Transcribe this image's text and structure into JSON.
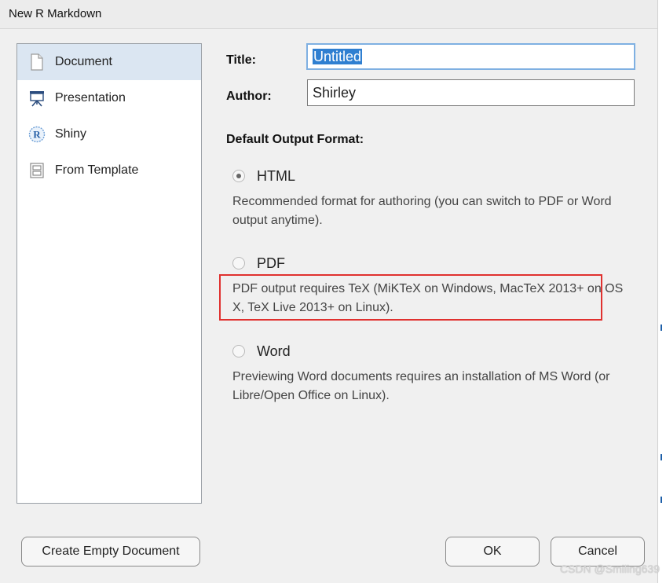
{
  "window": {
    "title": "New R Markdown"
  },
  "sidebar": {
    "items": [
      {
        "label": "Document",
        "icon": "document-icon",
        "selected": true
      },
      {
        "label": "Presentation",
        "icon": "presentation-icon",
        "selected": false
      },
      {
        "label": "Shiny",
        "icon": "shiny-r-icon",
        "selected": false
      },
      {
        "label": "From Template",
        "icon": "template-icon",
        "selected": false
      }
    ],
    "shiny_icon_glyph": "R"
  },
  "form": {
    "title_label": "Title:",
    "title_value": "Untitled",
    "author_label": "Author:",
    "author_value": "Shirley",
    "default_output_format_label": "Default Output Format:"
  },
  "formats": [
    {
      "label": "HTML",
      "checked": true,
      "description": "Recommended format for authoring (you can switch to PDF or Word output anytime)."
    },
    {
      "label": "PDF",
      "checked": false,
      "description": "PDF output requires TeX (MiKTeX on Windows, MacTeX 2013+ on OS X, TeX Live 2013+ on Linux)."
    },
    {
      "label": "Word",
      "checked": false,
      "description": "Previewing Word documents requires an installation of MS Word (or Libre/Open Office on Linux)."
    }
  ],
  "buttons": {
    "create_empty": "Create Empty Document",
    "ok": "OK",
    "cancel": "Cancel"
  },
  "watermark": "CSDN @Smiling639",
  "colors": {
    "selected_item_bg": "#dbe6f2",
    "text_selection": "#2f7fd1",
    "highlight_border": "#e0312f",
    "focus_border": "#7fb0e2"
  }
}
